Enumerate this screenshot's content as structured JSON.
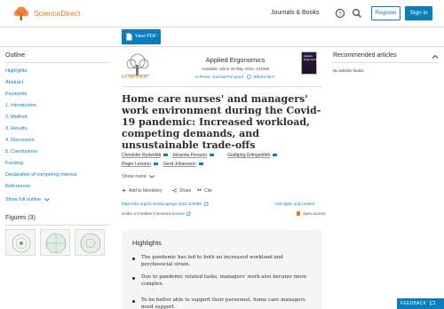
{
  "header": {
    "brand": "ScienceDirect",
    "journals_books": "Journals & Books",
    "register": "Register",
    "sign_in": "Sign in"
  },
  "toolbar": {
    "view_pdf": "View PDF"
  },
  "sidebar": {
    "outline_title": "Outline",
    "items": [
      "Highlights",
      "Abstract",
      "Keywords",
      "1. Introduction",
      "2. Method",
      "3. Results",
      "4. Discussion",
      "5. Conclusions",
      "Funding",
      "Declaration of competing interest",
      "References",
      "Show full outline"
    ],
    "figures_title": "Figures (3)"
  },
  "article": {
    "publisher": "ELSEVIER",
    "journal": "Applied Ergonomics",
    "available": "Available online 29 May 2023, 104056",
    "status": "In Press, Journal Pre-proof",
    "whats_this": "What's this?",
    "cover_text": "Applied Ergonomics",
    "title": "Home care nurses' and managers' work environment during the Covid-19 pandemic: Increased workload, competing demands, and unsustainable trade-offs",
    "authors": [
      "Christofer Rydenfält",
      "Johanna Persson",
      "Gudbjörg Erlingsdóttir",
      "Roger Larsson",
      "Gerd Johansson"
    ],
    "show_more": "Show more",
    "actions": {
      "mendeley": "Add to Mendeley",
      "share": "Share",
      "cite": "Cite"
    },
    "doi": "https://doi.org/10.1016/j.apergo.2023.104056",
    "rights": "Get rights and content",
    "license_prefix": "Under a Creative Commons",
    "license_link": "license",
    "open_access": "open access"
  },
  "highlights": {
    "title": "Highlights",
    "items": [
      "The pandemic has led to both an increased workload and psychosocial strain.",
      "Due to pandemic related tasks, managers' work also became more complex.",
      "To be better able to support their personnel, home care managers need support."
    ]
  },
  "recommended": {
    "title": "Recommended articles",
    "empty": "No articles found."
  },
  "feedback": "FEEDBACK",
  "colors": {
    "accent": "#0c7dbb",
    "brand": "#e9711c"
  }
}
